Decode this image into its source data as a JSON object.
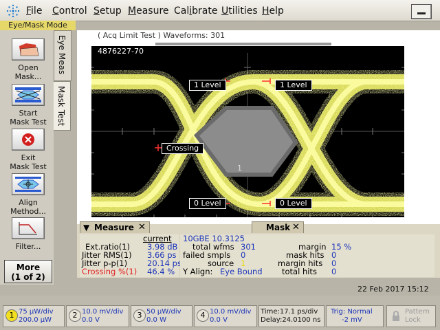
{
  "menubar": {
    "items": [
      {
        "accel": "F",
        "rest": "ile"
      },
      {
        "accel": "C",
        "rest": "ontrol"
      },
      {
        "accel": "S",
        "rest": "etup"
      },
      {
        "accel": "M",
        "rest": "easure"
      },
      {
        "accel": "",
        "pre": "Cal",
        "accel2": "i",
        "rest": "brate"
      },
      {
        "accel": "U",
        "rest": "tilities"
      },
      {
        "accel": "H",
        "rest": "elp"
      }
    ]
  },
  "mode_title": "Eye/Mask Mode",
  "left_buttons": {
    "open_mask": [
      "Open",
      "Mask..."
    ],
    "start_mask": [
      "Start",
      "Mask Test"
    ],
    "exit_mask": [
      "Exit",
      "Mask Test"
    ],
    "align": [
      "Align",
      "Method..."
    ],
    "filter": [
      "Filter..."
    ],
    "more_line1": "More",
    "more_line2": "(1 of 2)"
  },
  "tabs": {
    "eye_meas": "Eye Meas",
    "mask_test": "Mask Test"
  },
  "display": {
    "acq_status": "( Acq Limit Test )  Waveforms: 301",
    "waveform_id": "4876227-70",
    "label_1_level": "1 Level",
    "label_0_level": "0 Level",
    "label_crossing": "Crossing",
    "mask_region_number": "1"
  },
  "measure_panel": {
    "title": "Measure",
    "column_header": "current",
    "rows": [
      {
        "name": "Ext.ratio(1)",
        "value": "3.98 dB",
        "highlight": false
      },
      {
        "name": "Jitter RMS(1)",
        "value": "3.66 ps",
        "highlight": false
      },
      {
        "name": "Jitter p-p(1)",
        "value": "20.14 ps",
        "highlight": false
      },
      {
        "name": "Crossing %(1)",
        "value": "46.4 %",
        "highlight": true
      }
    ]
  },
  "mask_panel": {
    "title": "Mask",
    "standard": "10GBE 10.3125",
    "total_wfms_label": "total wfms",
    "total_wfms": "301",
    "failed_smpls_label": "failed smpls",
    "failed_smpls": "0",
    "source_label": "source",
    "source": "1",
    "yalign_label": "Y Align:",
    "yalign": "Eye Bound",
    "margin_label": "margin",
    "margin": "15 %",
    "mask_hits_label": "mask hits",
    "mask_hits": "0",
    "margin_hits_label": "margin hits",
    "margin_hits": "0",
    "total_hits_label": "total hits",
    "total_hits": "0"
  },
  "datetime": "22 Feb 2017   15:12",
  "channels": [
    {
      "num": "1",
      "line1": "75 µW/div",
      "line2": "200.0 µW",
      "active": true
    },
    {
      "num": "2",
      "line1": "10.0 mV/div",
      "line2": "0.0 V",
      "active": false
    },
    {
      "num": "3",
      "line1": "50 µW/div",
      "line2": "0.0 W",
      "active": false
    },
    {
      "num": "4",
      "line1": "10.0 mV/div",
      "line2": "0.0 V",
      "active": false
    }
  ],
  "timebase": {
    "line1": "Time:17.1 ps/div",
    "line2": "Delay:24.0100 ns"
  },
  "trigger": {
    "line1": "Trig: Normal",
    "line2": "-2 mV"
  },
  "pattern_lock": {
    "line1": "Pattern",
    "line2": "Lock"
  },
  "colors": {
    "eye_trace": "#e8ea50",
    "mask": "#8a8a8a",
    "measure_value": "#1a34b8",
    "crossing_highlight": "#e02020"
  }
}
